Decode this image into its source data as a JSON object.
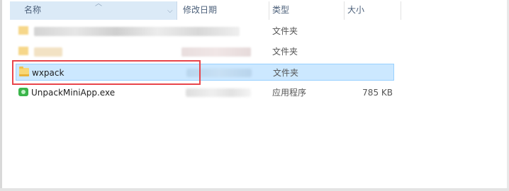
{
  "columns": {
    "name": "名称",
    "date_modified": "修改日期",
    "type": "类型",
    "size": "大小"
  },
  "files": [
    {
      "name": "",
      "type": "文件夹",
      "size": "",
      "icon": "folder-icon",
      "redacted": true
    },
    {
      "name": "",
      "type": "文件夹",
      "size": "",
      "icon": "folder-icon",
      "redacted": true
    },
    {
      "name": "wxpack",
      "type": "文件夹",
      "size": "",
      "icon": "folder-icon",
      "selected": true
    },
    {
      "name": "UnpackMiniApp.exe",
      "type": "应用程序",
      "size": "785 KB",
      "icon": "exe-icon"
    }
  ],
  "colors": {
    "selection_bg": "#cce8ff",
    "selection_border": "#99d1ff",
    "annotation_border": "#e8454b",
    "header_active_bg": "#dbeaf7"
  }
}
